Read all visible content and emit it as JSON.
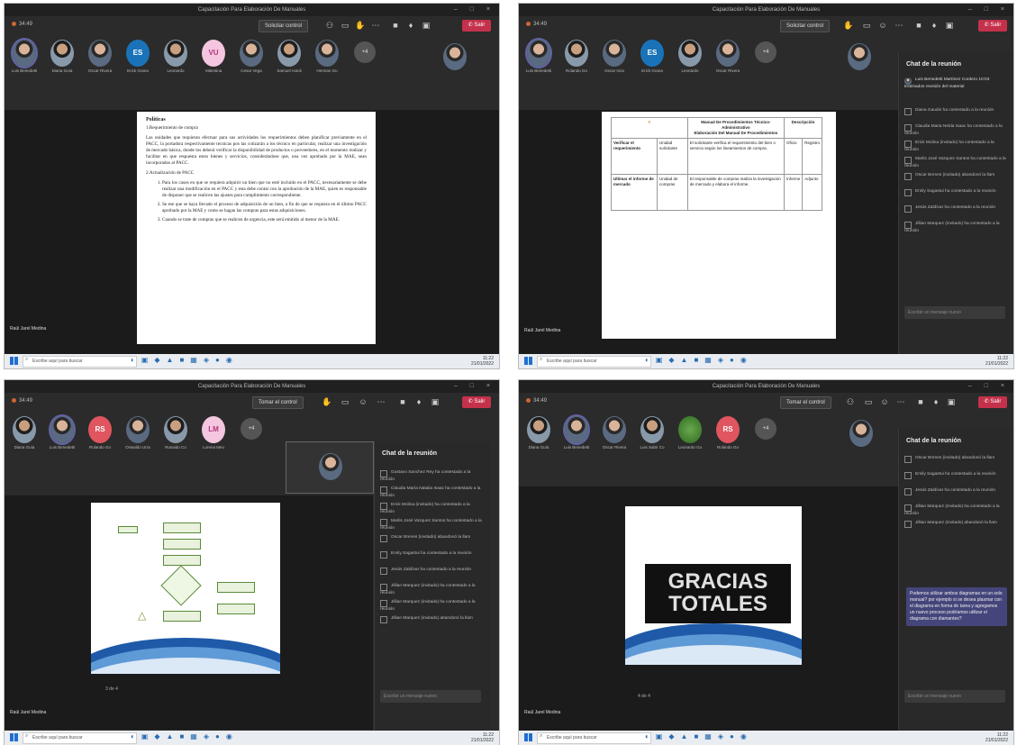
{
  "window_title": "Capacitación Para Elaboración De Manuales",
  "window_controls": "–  □  ×",
  "toolbar": {
    "timer": "34:49",
    "control_button": "Solicitar control",
    "control_button_alt": "Tomar el control",
    "leave_button": "Salir"
  },
  "screen1": {
    "participants": [
      "Luis Benedetti",
      "Diana Guía",
      "Oscar Rivera",
      "Erick Grana",
      "Leonardo",
      "Valentina",
      "Cesar Vega",
      "Samuel Astoli",
      "Herman Gu"
    ],
    "more_count": "+4",
    "presenter": "Raúl Jarel Medina",
    "doc_heading": "Políticas",
    "doc_sub": "1.Requerimiento de compra",
    "doc_para": "Las unidades que requieran efectuar para sus actividades los requerimientos deben planificar previamente en el PACC, la portadora respectivamente tecnicas pos las cotizarán a los técnico en particular, realizar una investigación de mercado básica, donde los deberá verificar la disponibilidad de productos o proveedores, en el momento realizar y facilitar en que respuesta estos bienes y servicios, considerándose que, una vez aprobado por la MAE, sean incorporados al PACC.",
    "doc_sub2": "2.Actualización de PACC",
    "doc_items": [
      "Para los casos en que se requiera adquirir un bien que no esté incluido en el PACC, necesariamente se debe realizar una modificación en el PACC y esta debe contar con la aprobación de la MAE, quien es responsable de disponer que se realicen las ajustes para cumplimiento correspondiente.",
      "Se ese que se haya llevado el proceso de adquisición de un bien, a fin de que se requiera en el último PACC aprobado por la MAE y como se hagan las compras para estas adquisiciones.",
      "Cuando se trate de compras que se realicen de urgencia, este será emitido al menor de la MAE."
    ]
  },
  "screen2": {
    "participants": [
      "Luis Benedetti",
      "Rolando Go",
      "Oscar Inza",
      "Erick Grana",
      "Leonardo",
      "Oscar Rivera"
    ],
    "more_count": "+4",
    "presenter": "Raúl Jarel Medina",
    "table_header_1": "Manual De Procedimientos Técnico-Administrativo",
    "table_header_2": "Elaboración Del Manual De Procedimientos",
    "table_header_3": "Descripción",
    "table_rows": [
      [
        "Verificar el requerimiento",
        "Unidad solicitante",
        "El solicitante verifica el requerimiento del bien o servicio según los lineamientos de compra.",
        "Días",
        "Oficio",
        "Registro"
      ],
      [
        "Ultimar el informe de mercado",
        "Unidad de compras",
        "El responsable de compras realiza la investigación de mercado y elabora el informe.",
        "Días",
        "Informe",
        "Adjunto"
      ]
    ],
    "chat_title": "Chat de la reunión",
    "chat_first": "Luis Benedetti Martínez Cordero 10:03 Estimados revisión del material",
    "chat_messages": [
      "Diana Gaudin ha contestado a la reunión",
      "Claudia Maria Nelda Isaac ha contestado a la reunión",
      "Erick Molina (invitado) ha contestado a la reunión",
      "Marlis José Vazquez Santos ha contestado a la reunión",
      "Oscar Brenes (invitado) abandonó la llam",
      "Emily Sagastui ha contestado a la reunión",
      "Jesús Zaldívar ha contestado a la reunión",
      "Jillian Marquez (invitado) ha contestado a la reunión"
    ],
    "chat_input": "Escribir un mensaje nuevo"
  },
  "screen3": {
    "participants": [
      "Diana Guía",
      "Luis Benedetti",
      "Rolando Go",
      "Oswaldo Urra",
      "Rosaido Co",
      "Lorena Meo"
    ],
    "initials_rs": "RS",
    "initials_lm": "LM",
    "more_count": "+4",
    "presenter": "Raúl Jarel Medina",
    "slide_counter": "3 de 4",
    "chat_title": "Chat de la reunión",
    "chat_messages": [
      "Gustavo Sanchez Rey ha contestado a la reunión",
      "Claudia María Natalia Isaac ha contestado a la reunión",
      "Erick Molina (invitado) ha contestado a la reunión",
      "Marlis José Vazquez Santos ha contestado a la reunión",
      "Oscar Brenes (invitado) abandonó la llam",
      "Emily Sagastui ha contestado a la reunión",
      "Jesús Zaldívar ha contestado a la reunión",
      "Jillian Marquez (invitado) ha contestado a la reunión",
      "Jillian Marquez (invitado) ha contestado a la reunión",
      "Jillian Marquez (invitado) abandonó la llam"
    ],
    "chat_input": "Escribir un mensaje nuevo"
  },
  "screen4": {
    "participants": [
      "Diana Guía",
      "Luis Benedetti",
      "Oscar Rivera",
      "Luis Sabir Co",
      "Leonardo Gu",
      "Rolando Go"
    ],
    "initials_rs": "RS",
    "more_count": "+4",
    "presenter": "Raúl Jarel Medina",
    "slide_title_line1": "GRACIAS",
    "slide_title_line2": "TOTALES",
    "slide_counter": "4 de 4",
    "chat_title": "Chat de la reunión",
    "chat_messages": [
      "Oscar Brenes (invitado) abandonó la llam",
      "Emily Sagastui ha contestado a la reunión",
      "Jesús Zaldívar ha contestado a la reunión",
      "Jillian Marquez (invitado) ha contestado a la reunión",
      "Jillian Marquez (invitado) abandonó la llam"
    ],
    "chat_bubble": "Podemos utilizar ambos diagramas en un solo manual? por ejemplo si se desea plasmar con el diagrama en forma de tarea y agregamos un nuevo proceso podríamos utilizar el diagrama con diamantes?",
    "chat_input": "Escribir un mensaje nuevo"
  },
  "taskbar": {
    "search_placeholder": "Escribe aquí para buscar",
    "time": "11:22",
    "date": "21/01/2022"
  },
  "colors": {
    "accent": "#6264a7",
    "leave": "#c4314b",
    "teams_dark": "#2b2b2b"
  }
}
